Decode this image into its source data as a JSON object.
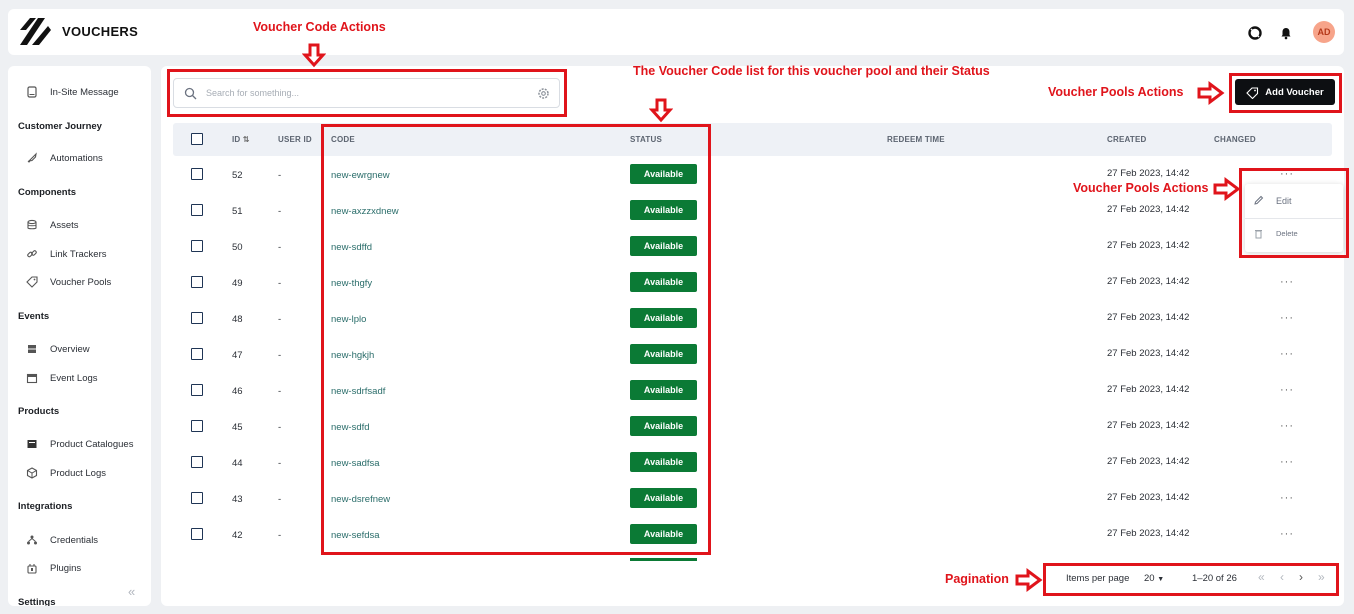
{
  "app": {
    "title": "VOUCHERS",
    "avatar_initials": "AD"
  },
  "header_icons": [
    "help-icon",
    "bell-icon"
  ],
  "sidebar": {
    "items_top": [
      {
        "label": "In-Site Message",
        "icon": "message-icon"
      }
    ],
    "sections": [
      {
        "title": "Customer Journey",
        "items": [
          {
            "label": "Automations",
            "icon": "rocket-icon"
          }
        ]
      },
      {
        "title": "Components",
        "items": [
          {
            "label": "Assets",
            "icon": "database-icon"
          },
          {
            "label": "Link Trackers",
            "icon": "link-icon"
          },
          {
            "label": "Voucher Pools",
            "icon": "ticket-icon"
          }
        ]
      },
      {
        "title": "Events",
        "items": [
          {
            "label": "Overview",
            "icon": "overview-icon"
          },
          {
            "label": "Event Logs",
            "icon": "calendar-icon"
          }
        ]
      },
      {
        "title": "Products",
        "items": [
          {
            "label": "Product Catalogues",
            "icon": "catalogue-icon"
          },
          {
            "label": "Product Logs",
            "icon": "box-icon"
          }
        ]
      },
      {
        "title": "Integrations",
        "items": [
          {
            "label": "Credentials",
            "icon": "credentials-icon"
          },
          {
            "label": "Plugins",
            "icon": "plugin-icon"
          }
        ]
      },
      {
        "title": "Settings",
        "items": []
      }
    ]
  },
  "search": {
    "placeholder": "Search for something..."
  },
  "toolbar": {
    "add_label": "Add Voucher"
  },
  "table": {
    "headers": {
      "id": "ID",
      "user_id": "USER ID",
      "code": "CODE",
      "status": "STATUS",
      "redeem_time": "REDEEM TIME",
      "created": "CREATED",
      "changed": "CHANGED"
    },
    "rows": [
      {
        "id": "52",
        "user_id": "-",
        "code": "new-ewrgnew",
        "status": "Available",
        "created": "27 Feb 2023, 14:42"
      },
      {
        "id": "51",
        "user_id": "-",
        "code": "new-axzzxdnew",
        "status": "Available",
        "created": "27 Feb 2023, 14:42"
      },
      {
        "id": "50",
        "user_id": "-",
        "code": "new-sdffd",
        "status": "Available",
        "created": "27 Feb 2023, 14:42"
      },
      {
        "id": "49",
        "user_id": "-",
        "code": "new-thgfy",
        "status": "Available",
        "created": "27 Feb 2023, 14:42"
      },
      {
        "id": "48",
        "user_id": "-",
        "code": "new-lplo",
        "status": "Available",
        "created": "27 Feb 2023, 14:42"
      },
      {
        "id": "47",
        "user_id": "-",
        "code": "new-hgkjh",
        "status": "Available",
        "created": "27 Feb 2023, 14:42"
      },
      {
        "id": "46",
        "user_id": "-",
        "code": "new-sdrfsadf",
        "status": "Available",
        "created": "27 Feb 2023, 14:42"
      },
      {
        "id": "45",
        "user_id": "-",
        "code": "new-sdfd",
        "status": "Available",
        "created": "27 Feb 2023, 14:42"
      },
      {
        "id": "44",
        "user_id": "-",
        "code": "new-sadfsa",
        "status": "Available",
        "created": "27 Feb 2023, 14:42"
      },
      {
        "id": "43",
        "user_id": "-",
        "code": "new-dsrefnew",
        "status": "Available",
        "created": "27 Feb 2023, 14:42"
      },
      {
        "id": "42",
        "user_id": "-",
        "code": "new-sefdsa",
        "status": "Available",
        "created": "27 Feb 2023, 14:42"
      }
    ],
    "row_menu": {
      "edit_label": "Edit",
      "delete_label": "Delete"
    },
    "actions_glyph": "···"
  },
  "pagination": {
    "items_per_page_label": "Items per page",
    "items_per_page_value": "20",
    "range": "1–20 of 26"
  },
  "annotations": {
    "code_actions": "Voucher Code Actions",
    "list_status": "The Voucher Code list for this voucher pool and their Status",
    "pool_actions_top": "Voucher Pools Actions",
    "pool_actions_menu": "Voucher Pools Actions",
    "pagination": "Pagination"
  },
  "colors": {
    "accent_red": "#e0141b",
    "status_green": "#0b7a35",
    "button_dark": "#0d0f12",
    "avatar": "#f7a48a"
  }
}
